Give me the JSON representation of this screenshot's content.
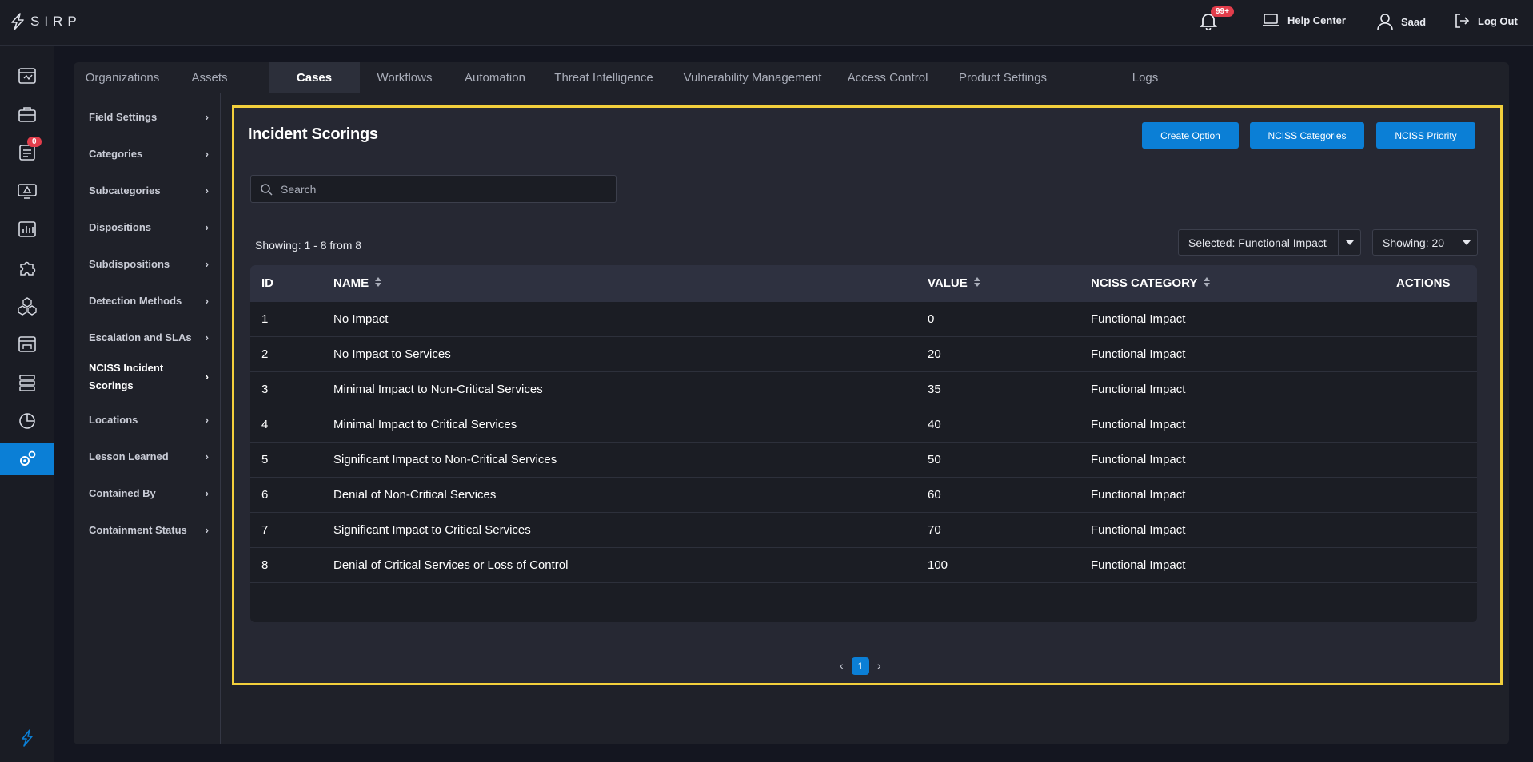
{
  "app": {
    "logo_text": "SIRP"
  },
  "topbar": {
    "notifications_badge": "99+",
    "help_center": "Help Center",
    "user_name": "Saad",
    "logout": "Log Out"
  },
  "rail": {
    "cases_badge": "0",
    "icons": [
      "dashboard-icon",
      "briefcase-icon",
      "cases-icon",
      "alert-monitor-icon",
      "bar-chart-icon",
      "puzzle-icon",
      "cubes-icon",
      "asset-icon",
      "server-icon",
      "pie-chart-icon",
      "settings-icon"
    ],
    "accent": "#0b7fd6"
  },
  "tabs": [
    {
      "label": "Organizations"
    },
    {
      "label": "Assets"
    },
    {
      "label": "Cases"
    },
    {
      "label": "Workflows"
    },
    {
      "label": "Automation"
    },
    {
      "label": "Threat Intelligence"
    },
    {
      "label": "Vulnerability Management"
    },
    {
      "label": "Access Control"
    },
    {
      "label": "Product Settings"
    },
    {
      "label": "Logs"
    }
  ],
  "subnav": [
    {
      "label": "Field Settings"
    },
    {
      "label": "Categories"
    },
    {
      "label": "Subcategories"
    },
    {
      "label": "Dispositions"
    },
    {
      "label": "Subdispositions"
    },
    {
      "label": "Detection Methods"
    },
    {
      "label": "Escalation and SLAs"
    },
    {
      "label": "NCISS Incident Scorings"
    },
    {
      "label": "Locations"
    },
    {
      "label": "Lesson Learned"
    },
    {
      "label": "Contained By"
    },
    {
      "label": "Containment Status"
    }
  ],
  "main": {
    "title": "Incident Scorings",
    "buttons": {
      "create": "Create Option",
      "categories": "NCISS Categories",
      "priority": "NCISS Priority"
    },
    "search_placeholder": "Search",
    "showing_text": "Showing: 1 - 8 from 8",
    "selected_dropdown": "Selected: Functional Impact",
    "showing_dropdown": "Showing: 20",
    "highlight_color": "#f2cf3c"
  },
  "table": {
    "headers": {
      "id": "ID",
      "name": "NAME",
      "value": "VALUE",
      "category": "NCISS CATEGORY",
      "actions": "ACTIONS"
    },
    "rows": [
      {
        "id": "1",
        "name": "No Impact",
        "value": "0",
        "category": "Functional Impact"
      },
      {
        "id": "2",
        "name": "No Impact to Services",
        "value": "20",
        "category": "Functional Impact"
      },
      {
        "id": "3",
        "name": "Minimal Impact to Non-Critical Services",
        "value": "35",
        "category": "Functional Impact"
      },
      {
        "id": "4",
        "name": "Minimal Impact to Critical Services",
        "value": "40",
        "category": "Functional Impact"
      },
      {
        "id": "5",
        "name": "Significant Impact to Non-Critical Services",
        "value": "50",
        "category": "Functional Impact"
      },
      {
        "id": "6",
        "name": "Denial of Non-Critical Services",
        "value": "60",
        "category": "Functional Impact"
      },
      {
        "id": "7",
        "name": "Significant Impact to Critical Services",
        "value": "70",
        "category": "Functional Impact"
      },
      {
        "id": "8",
        "name": "Denial of Critical Services or Loss of Control",
        "value": "100",
        "category": "Functional Impact"
      }
    ]
  },
  "pagination": {
    "current": "1"
  }
}
